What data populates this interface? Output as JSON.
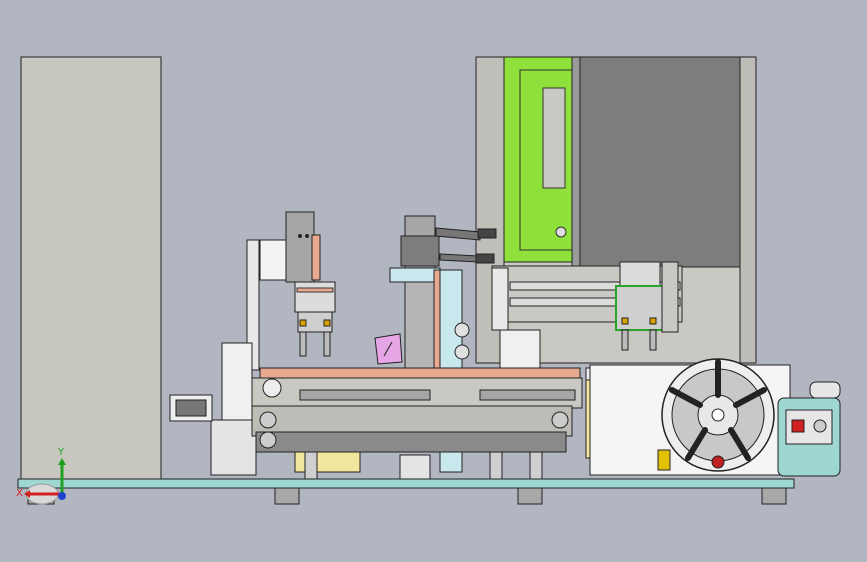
{
  "scene": {
    "background": "#b1b6c0",
    "description_colors": {
      "cabinet": "#c8c7bf",
      "dark_panel": "#7d7d7d",
      "green_panel": "#8fe03a",
      "base_plate": "#9ed6d2",
      "copper": "#e7a98f",
      "yellow": "#f2e69c",
      "pink": "#e6a6e6"
    }
  },
  "triad": {
    "x_label": "X",
    "y_label": "Y",
    "x_color": "#d22020",
    "y_color": "#20a020",
    "z_color": "#2040d0"
  }
}
